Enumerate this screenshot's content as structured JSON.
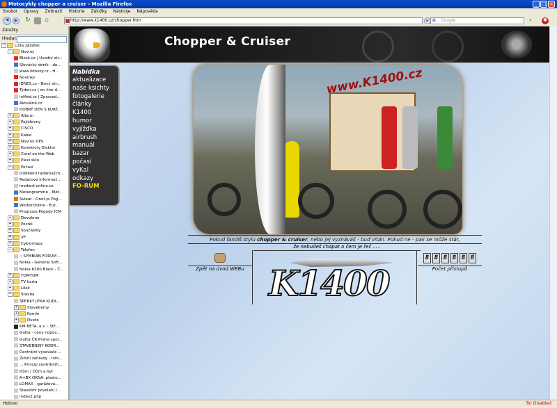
{
  "window": {
    "title": "Motocykly chopper a cruiser - Mozilla Firefox",
    "buttons": [
      "_",
      "□",
      "×"
    ]
  },
  "menubar": [
    "Soubor",
    "Úpravy",
    "Zobrazit",
    "Historie",
    "Záložky",
    "Nástroje",
    "Nápověda"
  ],
  "navbar": {
    "url": "http://www.k1400.cz/chopper.htm",
    "search_placeholder": "Google"
  },
  "sidebar": {
    "title": "Záložky",
    "search_label": "Hledat:",
    "items": [
      {
        "label": "Lišta záložek",
        "level": 0,
        "type": "folder",
        "open": true
      },
      {
        "label": "Noviny",
        "level": 1,
        "type": "folder",
        "open": true
      },
      {
        "label": "Blesk.cz | Úvodní str...",
        "level": 2,
        "type": "page",
        "color": "#e22"
      },
      {
        "label": "Slovácký deník - de...",
        "level": 2,
        "type": "page",
        "color": "#4a72c8"
      },
      {
        "label": "www.lidovky.cz - H...",
        "level": 2,
        "type": "page",
        "color": "#ccc"
      },
      {
        "label": "Novinky",
        "level": 2,
        "type": "page",
        "color": "#e22"
      },
      {
        "label": "iDNES.cz - Nový str...",
        "level": 2,
        "type": "page",
        "color": "#e22"
      },
      {
        "label": "Týden.cz | on-line d...",
        "level": 2,
        "type": "page",
        "color": "#e22"
      },
      {
        "label": "inMed.cz | Zpravod...",
        "level": 2,
        "type": "page",
        "color": "#ccc"
      },
      {
        "label": "Aktuálně.cz",
        "level": 2,
        "type": "page",
        "color": "#4a72c8"
      },
      {
        "label": "DOBRÝ DEN S KURÝ...",
        "level": 2,
        "type": "page",
        "color": "#ccc"
      },
      {
        "label": "Album",
        "level": 1,
        "type": "folder"
      },
      {
        "label": "Pojišťovny",
        "level": 1,
        "type": "folder"
      },
      {
        "label": "CISCO",
        "level": 1,
        "type": "folder"
      },
      {
        "label": "Kabel",
        "level": 1,
        "type": "folder"
      },
      {
        "label": "Noviny DPS",
        "level": 1,
        "type": "folder"
      },
      {
        "label": "Konektory Elektor",
        "level": 1,
        "type": "folder"
      },
      {
        "label": "Corel on the Web",
        "level": 1,
        "type": "folder"
      },
      {
        "label": "Plexi sklo",
        "level": 1,
        "type": "folder"
      },
      {
        "label": "Počasí",
        "level": 1,
        "type": "folder",
        "open": true
      },
      {
        "label": "Oddělení radarových...",
        "level": 2,
        "type": "page",
        "color": "#ccc"
      },
      {
        "label": "Radarové informaci...",
        "level": 2,
        "type": "page",
        "color": "#ccc"
      },
      {
        "label": "medard-online.cz",
        "level": 2,
        "type": "page",
        "color": "#ccc"
      },
      {
        "label": "Meteogramme - Mét...",
        "level": 2,
        "type": "page",
        "color": "#4a72c8"
      },
      {
        "label": "Svieat - Onet.pl Pog...",
        "level": 2,
        "type": "page",
        "color": "#e8720c"
      },
      {
        "label": "WetterOnline - Eur...",
        "level": 2,
        "type": "page",
        "color": "#4a72c8"
      },
      {
        "label": "Prognoza Pogody ICM",
        "level": 2,
        "type": "page",
        "color": "#ccc"
      },
      {
        "label": "Dovolene",
        "level": 1,
        "type": "folder"
      },
      {
        "label": "Postel",
        "level": 1,
        "type": "folder"
      },
      {
        "label": "Součástky",
        "level": 1,
        "type": "folder"
      },
      {
        "label": "VF",
        "level": 1,
        "type": "folder"
      },
      {
        "label": "Cyklomapy",
        "level": 1,
        "type": "folder"
      },
      {
        "label": "Telefon",
        "level": 1,
        "type": "folder",
        "open": true
      },
      {
        "label": ":: SYMBIAN FORUM ...",
        "level": 2,
        "type": "page",
        "color": "#ccc"
      },
      {
        "label": "Nokia - General Soft...",
        "level": 2,
        "type": "page",
        "color": "#ccc"
      },
      {
        "label": "Nokia 6300 Black - Č...",
        "level": 2,
        "type": "page",
        "color": "#ccc"
      },
      {
        "label": "TOMTOM",
        "level": 1,
        "type": "folder"
      },
      {
        "label": "TV karta",
        "level": 1,
        "type": "folder"
      },
      {
        "label": "Lilež",
        "level": 1,
        "type": "folder"
      },
      {
        "label": "Stavba",
        "level": 1,
        "type": "folder",
        "open": true
      },
      {
        "label": "ŠPERKY JITKA KUDL...",
        "level": 2,
        "type": "page",
        "color": "#ccc"
      },
      {
        "label": "Stavebniny",
        "level": 2,
        "type": "folder"
      },
      {
        "label": "Komín",
        "level": 2,
        "type": "folder"
      },
      {
        "label": "Dveře",
        "level": 2,
        "type": "folder"
      },
      {
        "label": "KM BETA, a.s. - Stř...",
        "level": 2,
        "type": "page",
        "color": "#222"
      },
      {
        "label": "Gutta - ceny nopov...",
        "level": 2,
        "type": "page",
        "color": "#ccc"
      },
      {
        "label": "Gutta ČR Praha spol...",
        "level": 2,
        "type": "page",
        "color": "#ccc"
      },
      {
        "label": "STAVEBNINY KODR...",
        "level": 2,
        "type": "page",
        "color": "#ccc"
      },
      {
        "label": "Centrální vysavače ...",
        "level": 2,
        "type": "page",
        "color": "#ccc"
      },
      {
        "label": "Zimní zahrady - Info...",
        "level": 2,
        "type": "page",
        "color": "#ccc"
      },
      {
        "label": "....Princip centrálníh...",
        "level": 2,
        "type": "page",
        "color": "#ccc"
      },
      {
        "label": "Dům | Dům a byt",
        "level": 2,
        "type": "page",
        "color": "#ccc"
      },
      {
        "label": "A+BX OKNA: plasto...",
        "level": 2,
        "type": "page",
        "color": "#ccc"
      },
      {
        "label": "LOMAX - garážová...",
        "level": 2,
        "type": "page",
        "color": "#ccc"
      },
      {
        "label": "Stavební povolení /...",
        "level": 2,
        "type": "page",
        "color": "#ccc"
      },
      {
        "label": "index2.php",
        "level": 2,
        "type": "page",
        "color": "#ccc"
      },
      {
        "label": "Stavba domu",
        "level": 2,
        "type": "page",
        "color": "#ccc"
      }
    ]
  },
  "status": {
    "left": "Hotovo",
    "right": "Tor Disabled"
  },
  "page": {
    "banner_title": "Chopper & Cruiser",
    "nav_heading": "Nabídka",
    "nav_items": [
      {
        "label": "aktualizace",
        "highlight": false
      },
      {
        "label": "naše ksichty",
        "highlight": false
      },
      {
        "label": "fotogalerie",
        "highlight": false
      },
      {
        "label": "články",
        "highlight": false
      },
      {
        "label": "K1400",
        "highlight": false
      },
      {
        "label": "humor",
        "highlight": false
      },
      {
        "label": "vyjížďka",
        "highlight": false
      },
      {
        "label": "airbrush",
        "highlight": false
      },
      {
        "label": "manuál",
        "highlight": false
      },
      {
        "label": "bazar",
        "highlight": false
      },
      {
        "label": "počasí",
        "highlight": false
      },
      {
        "label": "vyKal",
        "highlight": false
      },
      {
        "label": "odkazy",
        "highlight": false
      },
      {
        "label": "FO-RUM",
        "highlight": true
      }
    ],
    "image_text": "www.K1400.cz",
    "caption_line1": "Pokud  fandíš stylu chopper & cruiser, nebo jej vyznáváš - buď vítán. Pokud ne - pak se může stát,",
    "caption_line2": "že nebudeš chápat o čem je řeč .....",
    "back_link": "Zpět na úvod WEBu",
    "logo_text": "K1400",
    "counter_digits": [
      "8",
      "8",
      "8",
      "8",
      "8",
      "8"
    ],
    "counter_label": "Počet přístupů"
  }
}
